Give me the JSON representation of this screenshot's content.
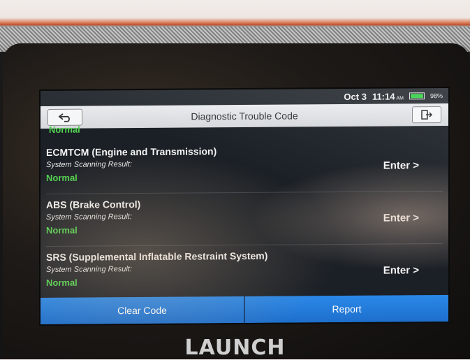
{
  "statusbar": {
    "date": "Oct 3",
    "time": "11:14",
    "time_suffix": "AM",
    "battery_percent": "98%",
    "battery_level": 0.98
  },
  "header": {
    "title": "Diagnostic Trouble Code",
    "back_icon": "back-arrow-icon",
    "exit_icon": "exit-icon"
  },
  "list": {
    "top_status": "Normal",
    "items": [
      {
        "name": "ECMTCM (Engine and Transmission)",
        "label": "System Scanning Result:",
        "result": "Normal",
        "action": "Enter >"
      },
      {
        "name": "ABS (Brake Control)",
        "label": "System Scanning Result:",
        "result": "Normal",
        "action": "Enter >"
      },
      {
        "name": "SRS (Supplemental Inflatable Restraint System)",
        "label": "System Scanning Result:",
        "result": "Normal",
        "action": "Enter >"
      }
    ]
  },
  "bottom": {
    "clear_code": "Clear Code",
    "report": "Report"
  },
  "brand": "LAUNCH",
  "colors": {
    "normal_green": "#4fd34f",
    "button_blue": "#1e6fcc"
  }
}
